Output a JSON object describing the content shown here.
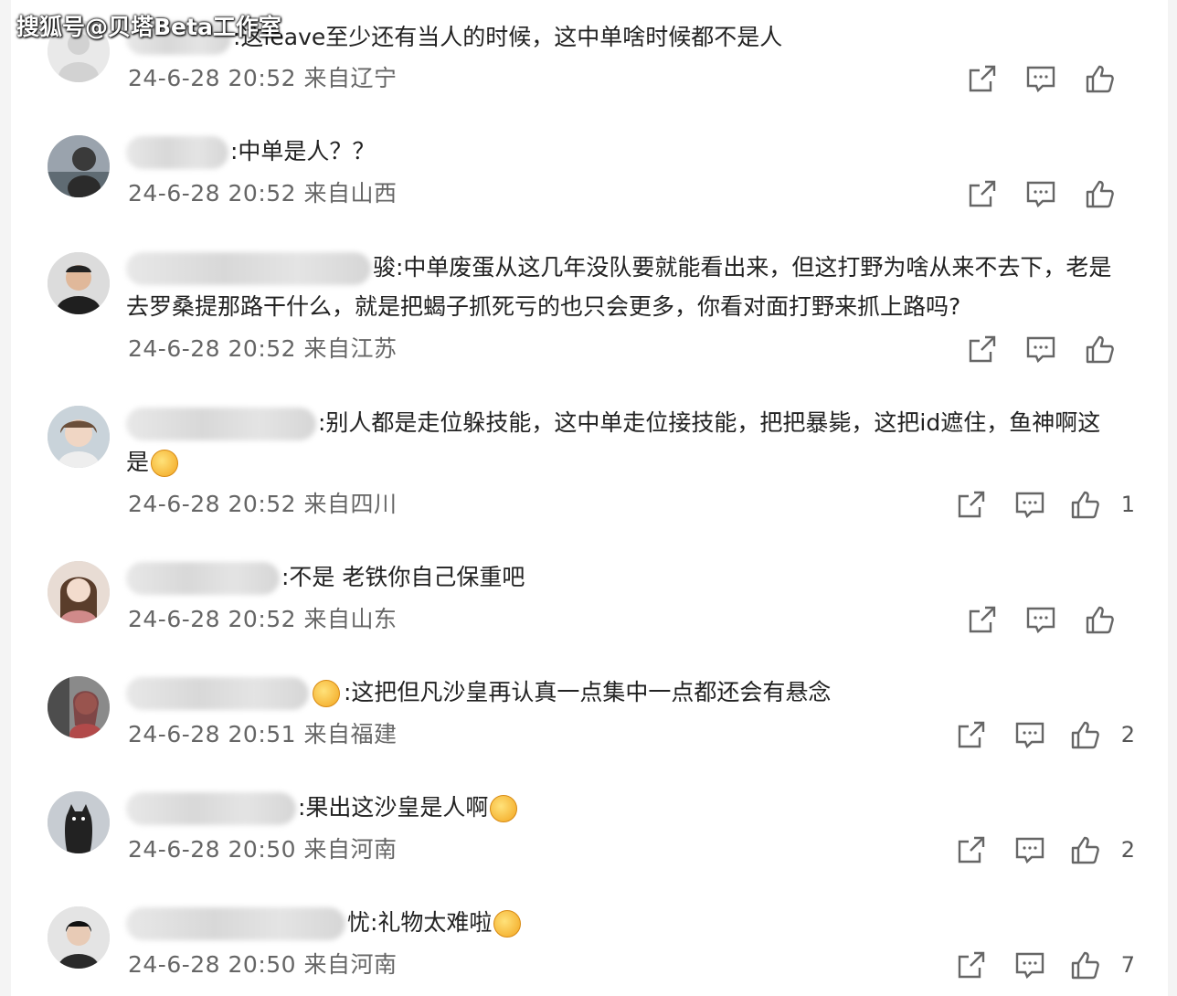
{
  "watermark": "搜狐号@贝塔Beta工作室",
  "comments": [
    {
      "text": ":这leave至少还有当人的时候，这中单啥时候都不是人",
      "text2": "",
      "time": "24-6-28 20:52",
      "location": "来自辽宁",
      "likes": ""
    },
    {
      "text": ":中单是人？？",
      "text2": "",
      "time": "24-6-28 20:52",
      "location": "来自山西",
      "likes": ""
    },
    {
      "text": "骏:中单废蛋从这几年没队要就能看出来，但这打野为啥从来不去下，老是",
      "text2": "去罗桑提那路干什么，就是把蝎子抓死亏的也只会更多，你看对面打野来抓上路吗?",
      "time": "24-6-28 20:52",
      "location": "来自江苏",
      "likes": ""
    },
    {
      "text": ":别人都是走位躲技能，这中单走位接技能，把把暴毙，这把id遮住，鱼神啊这",
      "text2": "是",
      "time": "24-6-28 20:52",
      "location": "来自四川",
      "likes": "1"
    },
    {
      "text": ":不是 老铁你自己保重吧",
      "text2": "",
      "time": "24-6-28 20:52",
      "location": "来自山东",
      "likes": ""
    },
    {
      "text": ":这把但凡沙皇再认真一点集中一点都还会有悬念",
      "text2": "",
      "time": "24-6-28 20:51",
      "location": "来自福建",
      "likes": "2"
    },
    {
      "text": ":果出这沙皇是人啊",
      "text2": "",
      "time": "24-6-28 20:50",
      "location": "来自河南",
      "likes": "2"
    },
    {
      "text": "忧:礼物太难啦",
      "text2": "",
      "time": "24-6-28 20:50",
      "location": "来自河南",
      "likes": "7"
    }
  ],
  "icons": {
    "share": "share-icon",
    "comment": "comment-icon",
    "like": "thumbs-up-icon"
  },
  "colors": {
    "text": "#222222",
    "meta": "#666666",
    "icon": "#666666",
    "background": "#ffffff"
  }
}
